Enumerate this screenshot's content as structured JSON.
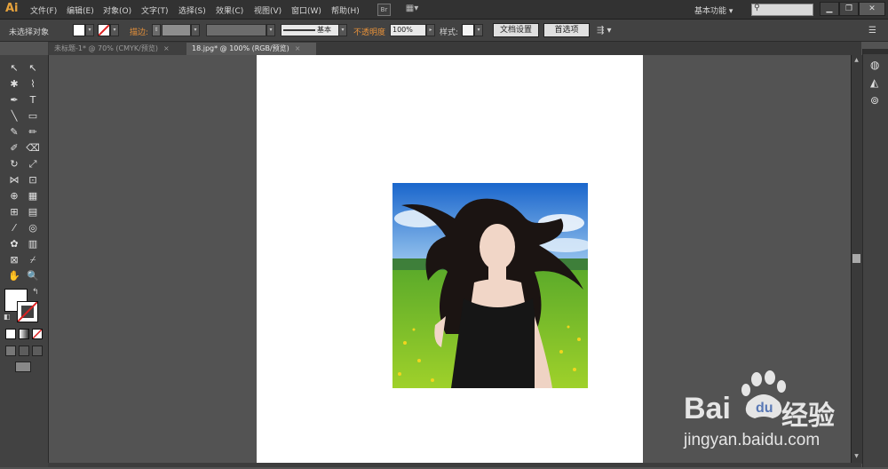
{
  "app": {
    "logo": "Ai"
  },
  "menu": [
    "文件(F)",
    "编辑(E)",
    "对象(O)",
    "文字(T)",
    "选择(S)",
    "效果(C)",
    "视图(V)",
    "窗口(W)",
    "帮助(H)"
  ],
  "menubar_extras": {
    "bridge_label": "Br",
    "arrange_label": "▦▾"
  },
  "workspace": {
    "label": "基本功能",
    "search_placeholder": ""
  },
  "window_controls": [
    "▁",
    "❐",
    "✕"
  ],
  "control_bar": {
    "selection_label": "未选择对象",
    "stroke_label": "描边:",
    "stroke_style_label": "基本",
    "opacity_label": "不透明度",
    "opacity_value": "100%",
    "style_label": "样式:",
    "document_setup_button": "文档设置",
    "preferences_button": "首选项"
  },
  "tabs": [
    {
      "label": "未标题-1* @ 70% (CMYK/预览)",
      "active": false,
      "close": "×"
    },
    {
      "label": "18.jpg* @ 100% (RGB/预览)",
      "active": true,
      "close": "×"
    }
  ],
  "tools": [
    [
      "selection-tool-icon",
      "direct-selection-tool-icon"
    ],
    [
      "magic-wand-tool-icon",
      "lasso-tool-icon"
    ],
    [
      "pen-tool-icon",
      "type-tool-icon"
    ],
    [
      "line-segment-tool-icon",
      "rectangle-tool-icon"
    ],
    [
      "paintbrush-tool-icon",
      "pencil-tool-icon"
    ],
    [
      "blob-brush-tool-icon",
      "eraser-tool-icon"
    ],
    [
      "rotate-tool-icon",
      "scale-tool-icon"
    ],
    [
      "width-tool-icon",
      "free-transform-tool-icon"
    ],
    [
      "shape-builder-tool-icon",
      "perspective-grid-tool-icon"
    ],
    [
      "mesh-tool-icon",
      "gradient-tool-icon"
    ],
    [
      "eyedropper-tool-icon",
      "blend-tool-icon"
    ],
    [
      "symbol-sprayer-tool-icon",
      "column-graph-tool-icon"
    ],
    [
      "artboard-tool-icon",
      "slice-tool-icon"
    ],
    [
      "hand-tool-icon",
      "zoom-tool-icon"
    ]
  ],
  "tool_glyphs": [
    [
      "↖",
      "↖"
    ],
    [
      "✱",
      "⌇"
    ],
    [
      "✒",
      "T"
    ],
    [
      "╲",
      "▭"
    ],
    [
      "✎",
      "✏"
    ],
    [
      "✐",
      "⌫"
    ],
    [
      "↻",
      "⤢"
    ],
    [
      "⋈",
      "⊡"
    ],
    [
      "⊕",
      "▦"
    ],
    [
      "⊞",
      "▤"
    ],
    [
      "⁄",
      "◎"
    ],
    [
      "✿",
      "▥"
    ],
    [
      "⊠",
      "⌿"
    ],
    [
      "✋",
      "🔍"
    ]
  ],
  "watermark": {
    "brand": "Bai",
    "du_text": "du",
    "jingyan": "经验",
    "url": "jingyan.baidu.com"
  },
  "colors": {
    "accent_orange": "#e8923a",
    "logo": "#e6a23c",
    "panel": "#424242",
    "canvas": "#535353"
  }
}
